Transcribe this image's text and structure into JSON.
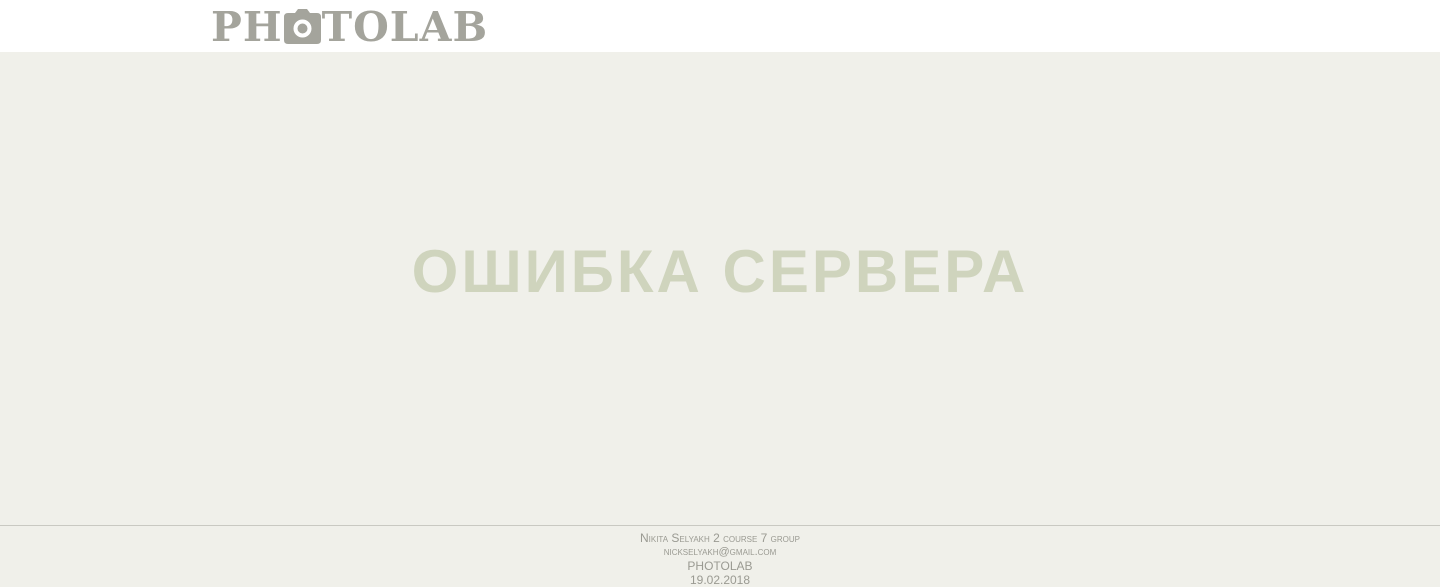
{
  "header": {
    "logo_left": "PH",
    "logo_icon": "camera-icon",
    "logo_right": "TOLAB"
  },
  "main": {
    "error_title": "ОШИБКА СЕРВЕРА"
  },
  "footer": {
    "author": "Nikita Selyakh 2 course 7 group",
    "email": "nickselyakh@gmail.com",
    "brand": "PHOTOLAB",
    "date": "19.02.2018"
  },
  "colors": {
    "logo": "#a4a49c",
    "background": "#f0f0ea",
    "error_title": "#cfd4bd",
    "footer_text": "#9a9a92"
  }
}
